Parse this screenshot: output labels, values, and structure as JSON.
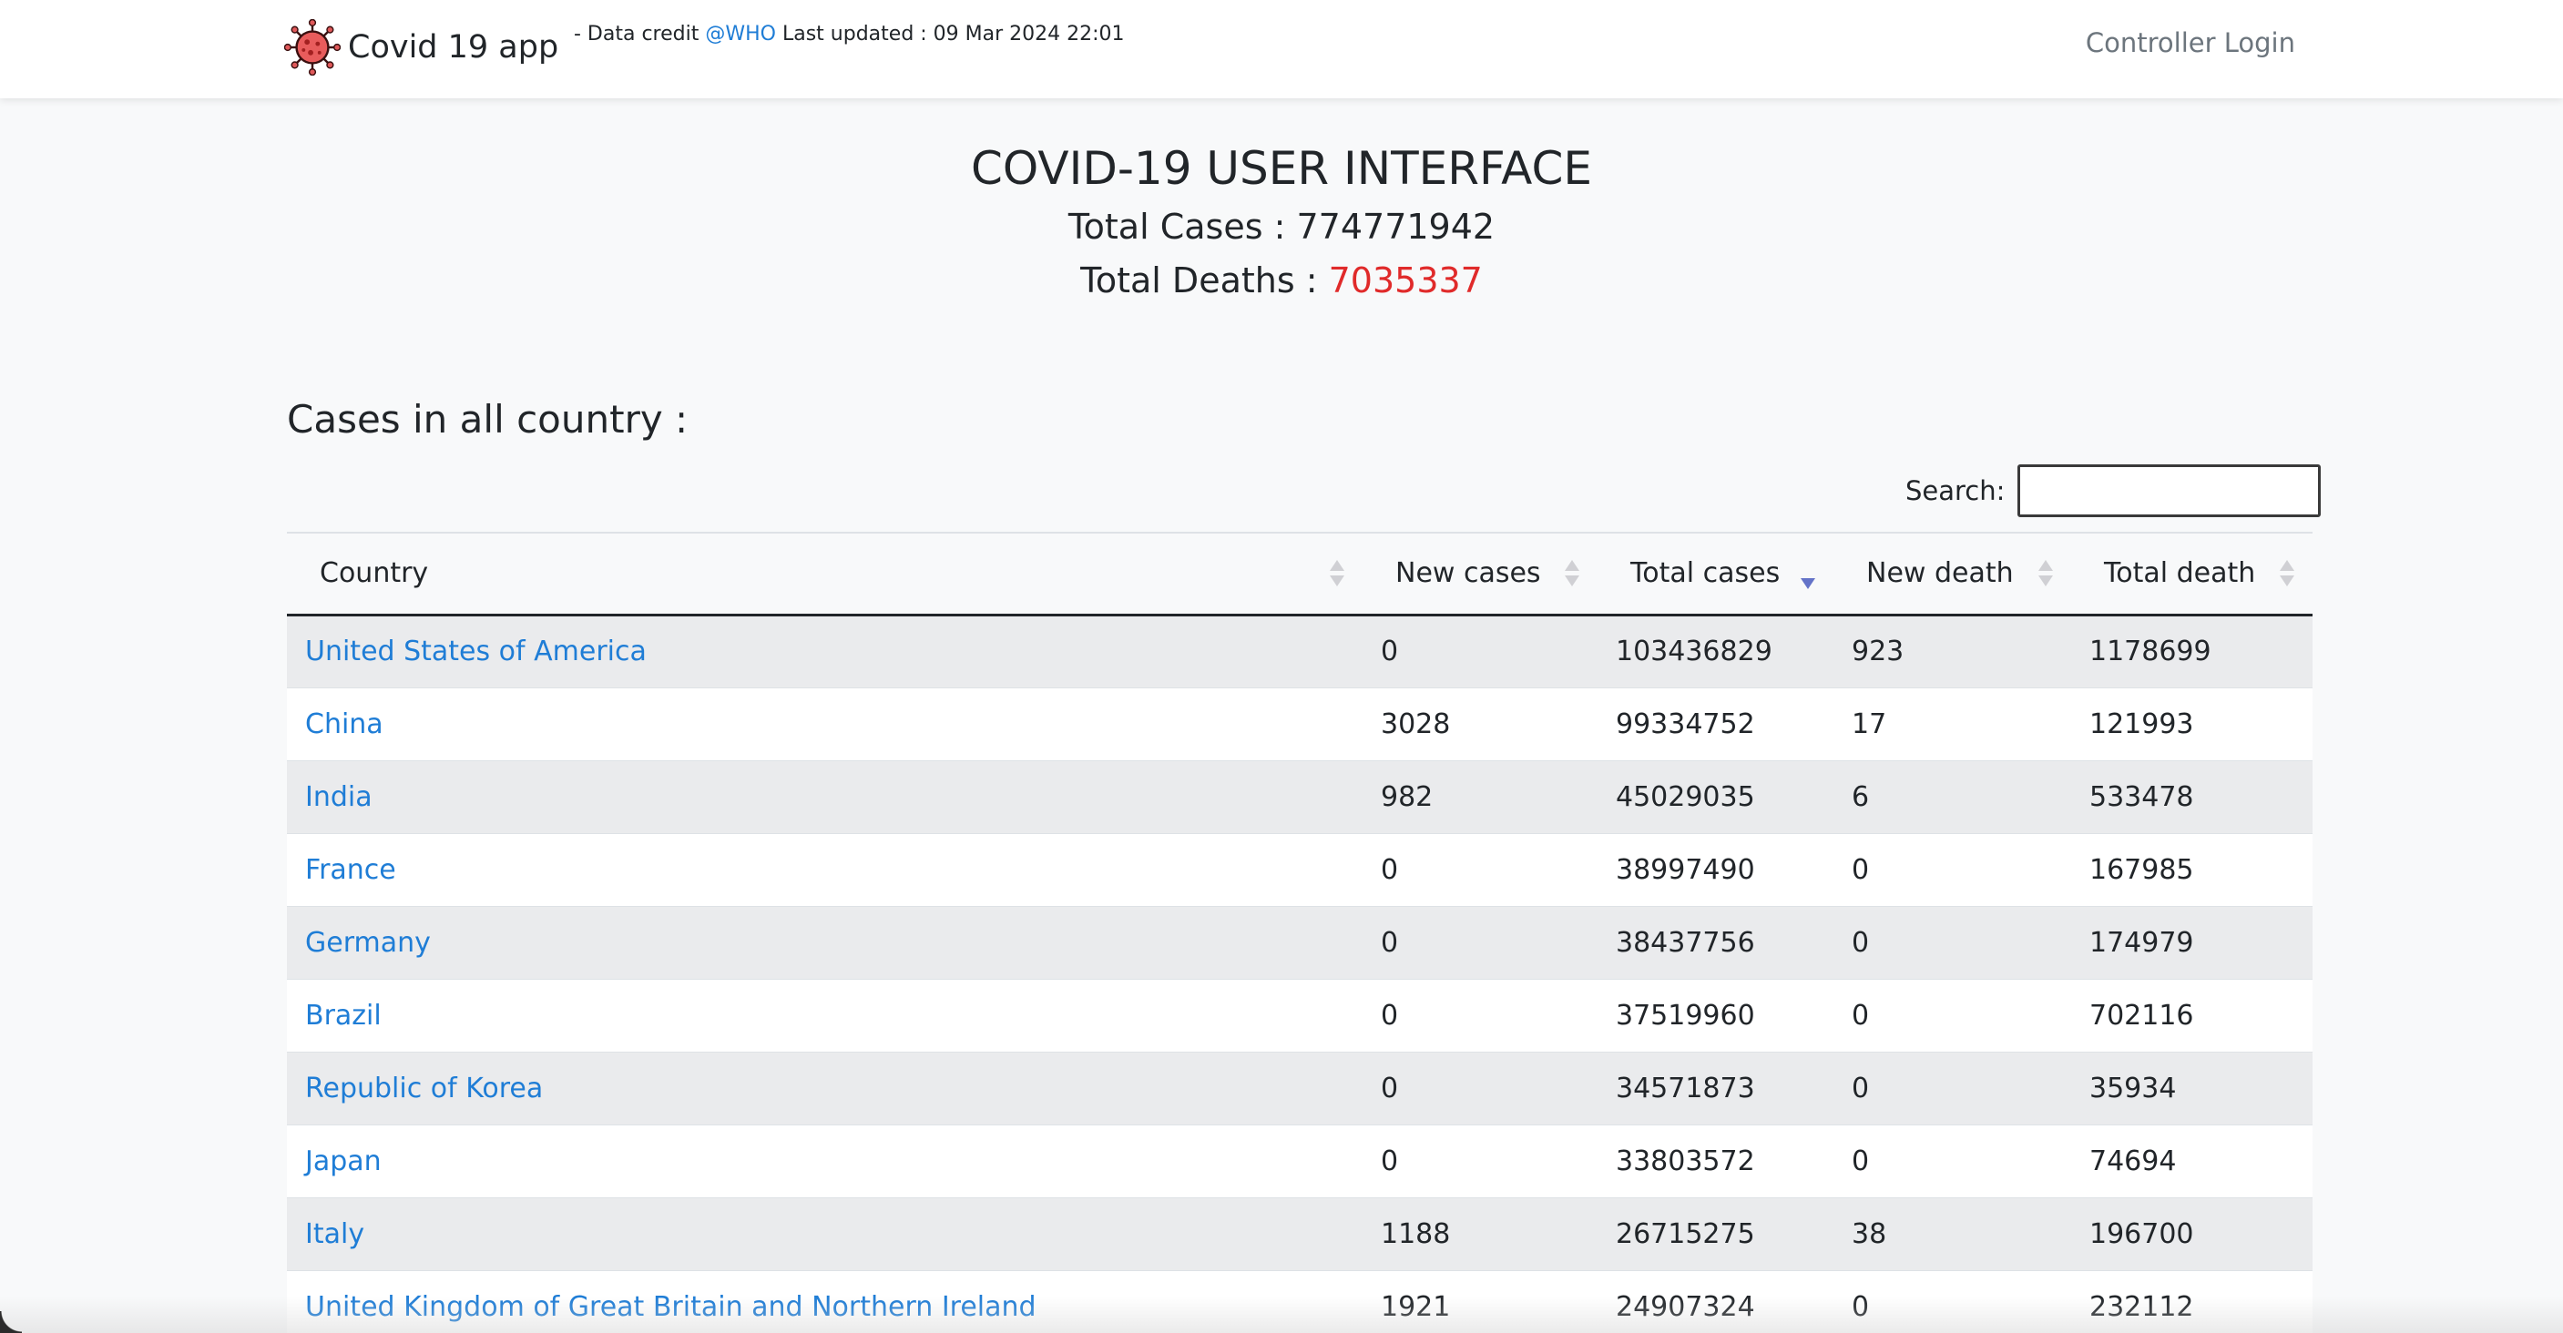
{
  "navbar": {
    "brand_name": "Covid 19 app",
    "credit_prefix": "- Data credit",
    "credit_link": "@WHO",
    "updated_text": "Last updated : 09 Mar 2024 22:01",
    "login_label": "Controller Login"
  },
  "summary": {
    "title": "COVID-19 USER INTERFACE",
    "total_cases_label": "Total Cases :",
    "total_cases_value": "774771942",
    "total_deaths_label": "Total Deaths :",
    "total_deaths_value": "7035337",
    "deaths_color": "#e02a2a"
  },
  "section_title": "Cases in all country :",
  "search": {
    "label": "Search:",
    "value": ""
  },
  "table": {
    "columns": [
      "Country",
      "New cases",
      "Total cases",
      "New death",
      "Total death"
    ],
    "sorted_column": "Total cases",
    "sort_direction": "descending",
    "rows": [
      {
        "country": "United States of America",
        "new_cases": "0",
        "total_cases": "103436829",
        "new_death": "923",
        "total_death": "1178699"
      },
      {
        "country": "China",
        "new_cases": "3028",
        "total_cases": "99334752",
        "new_death": "17",
        "total_death": "121993"
      },
      {
        "country": "India",
        "new_cases": "982",
        "total_cases": "45029035",
        "new_death": "6",
        "total_death": "533478"
      },
      {
        "country": "France",
        "new_cases": "0",
        "total_cases": "38997490",
        "new_death": "0",
        "total_death": "167985"
      },
      {
        "country": "Germany",
        "new_cases": "0",
        "total_cases": "38437756",
        "new_death": "0",
        "total_death": "174979"
      },
      {
        "country": "Brazil",
        "new_cases": "0",
        "total_cases": "37519960",
        "new_death": "0",
        "total_death": "702116"
      },
      {
        "country": "Republic of Korea",
        "new_cases": "0",
        "total_cases": "34571873",
        "new_death": "0",
        "total_death": "35934"
      },
      {
        "country": "Japan",
        "new_cases": "0",
        "total_cases": "33803572",
        "new_death": "0",
        "total_death": "74694"
      },
      {
        "country": "Italy",
        "new_cases": "1188",
        "total_cases": "26715275",
        "new_death": "38",
        "total_death": "196700"
      },
      {
        "country": "United Kingdom of Great Britain and Northern Ireland",
        "new_cases": "1921",
        "total_cases": "24907324",
        "new_death": "0",
        "total_death": "232112"
      }
    ]
  },
  "colors": {
    "link": "#1f7dd6",
    "sort_active": "#6473c8",
    "stripe": "#eaebed"
  },
  "icons": {
    "brand": "virus-icon"
  }
}
